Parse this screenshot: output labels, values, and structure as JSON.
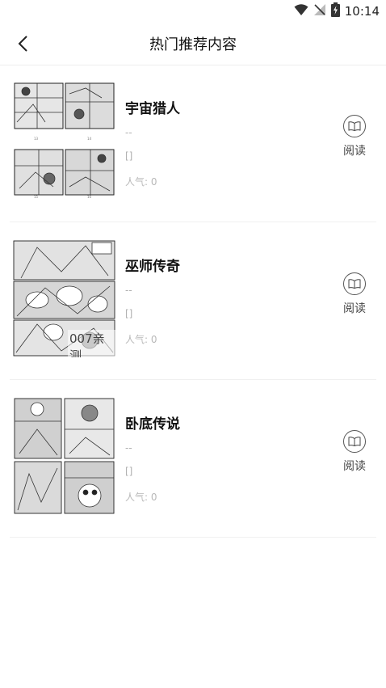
{
  "status_bar": {
    "time": "10:14"
  },
  "header": {
    "title": "热门推荐内容"
  },
  "items": [
    {
      "title": "宇宙猎人",
      "subtitle": "--",
      "chapter": "[]",
      "popularity": "人气: 0",
      "read_label": "阅读",
      "watermark": ""
    },
    {
      "title": "巫师传奇",
      "subtitle": "--",
      "chapter": "[]",
      "popularity": "人气: 0",
      "read_label": "阅读",
      "watermark": "007亲测"
    },
    {
      "title": "卧底传说",
      "subtitle": "--",
      "chapter": "[]",
      "popularity": "人气: 0",
      "read_label": "阅读",
      "watermark": ""
    }
  ],
  "icons": {
    "back": "chevron-left-icon",
    "read": "book-open-icon",
    "wifi": "wifi-icon",
    "signal": "no-signal-icon",
    "battery": "battery-charging-icon"
  }
}
